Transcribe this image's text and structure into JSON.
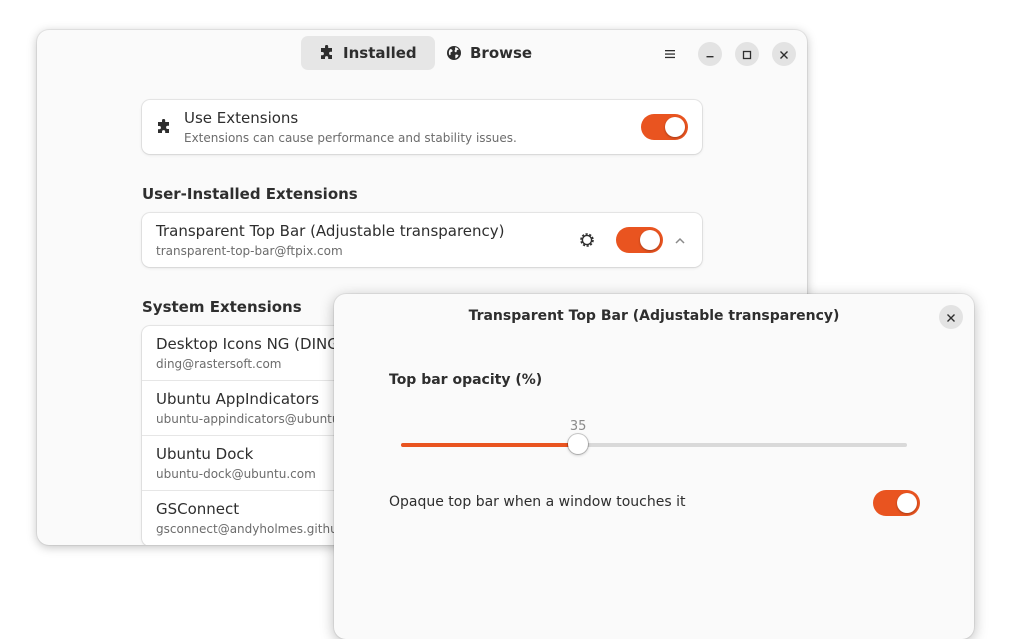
{
  "colors": {
    "accent": "#e95420"
  },
  "headerbar": {
    "tabs": [
      {
        "label": "Installed",
        "icon": "puzzle-icon",
        "active": true
      },
      {
        "label": "Browse",
        "icon": "globe-icon",
        "active": false
      }
    ],
    "buttons": [
      "menu-icon",
      "minimize-icon",
      "maximize-icon",
      "close-icon"
    ]
  },
  "use_extensions": {
    "title": "Use Extensions",
    "subtitle": "Extensions can cause performance and stability issues.",
    "enabled": true
  },
  "user_section": {
    "title": "User-Installed Extensions",
    "items": [
      {
        "name": "Transparent Top Bar (Adjustable transparency)",
        "id": "transparent-top-bar@ftpix.com",
        "enabled": true
      }
    ]
  },
  "system_section": {
    "title": "System Extensions",
    "items": [
      {
        "name": "Desktop Icons NG (DING)",
        "id": "ding@rastersoft.com"
      },
      {
        "name": "Ubuntu AppIndicators",
        "id": "ubuntu-appindicators@ubuntu.com"
      },
      {
        "name": "Ubuntu Dock",
        "id": "ubuntu-dock@ubuntu.com"
      },
      {
        "name": "GSConnect",
        "id": "gsconnect@andyholmes.github.io"
      }
    ]
  },
  "dialog": {
    "title": "Transparent Top Bar (Adjustable transparency)",
    "opacity_label": "Top bar opacity (%)",
    "opacity_value": "35",
    "opacity_fraction": 0.35,
    "opaque_label": "Opaque top bar when a window touches it",
    "opaque_enabled": true
  }
}
